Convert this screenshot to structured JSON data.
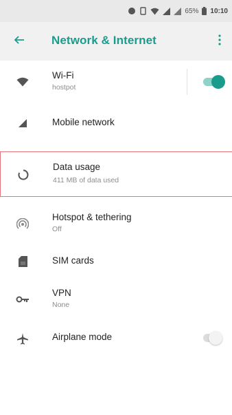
{
  "status_bar": {
    "battery_percent": "65%",
    "time": "10:10"
  },
  "app_bar": {
    "title": "Network & Internet"
  },
  "items": [
    {
      "id": "wifi",
      "label": "Wi-Fi",
      "summary": "hostpot",
      "icon": "wifi-icon",
      "toggle": true,
      "toggle_state": "on"
    },
    {
      "id": "mobile",
      "label": "Mobile network",
      "icon": "cellular-signal-icon"
    },
    {
      "id": "data",
      "label": "Data usage",
      "summary": "411 MB of data used",
      "icon": "data-usage-icon",
      "highlighted": true
    },
    {
      "id": "hotspot",
      "label": "Hotspot & tethering",
      "summary": "Off",
      "icon": "hotspot-icon"
    },
    {
      "id": "sim",
      "label": "SIM cards",
      "icon": "sim-card-icon"
    },
    {
      "id": "vpn",
      "label": "VPN",
      "summary": "None",
      "icon": "vpn-key-icon"
    },
    {
      "id": "airplane",
      "label": "Airplane mode",
      "icon": "airplane-icon",
      "toggle": true,
      "toggle_state": "off"
    }
  ],
  "colors": {
    "accent": "#1a9c8c",
    "highlight_border": "#e4737a"
  }
}
